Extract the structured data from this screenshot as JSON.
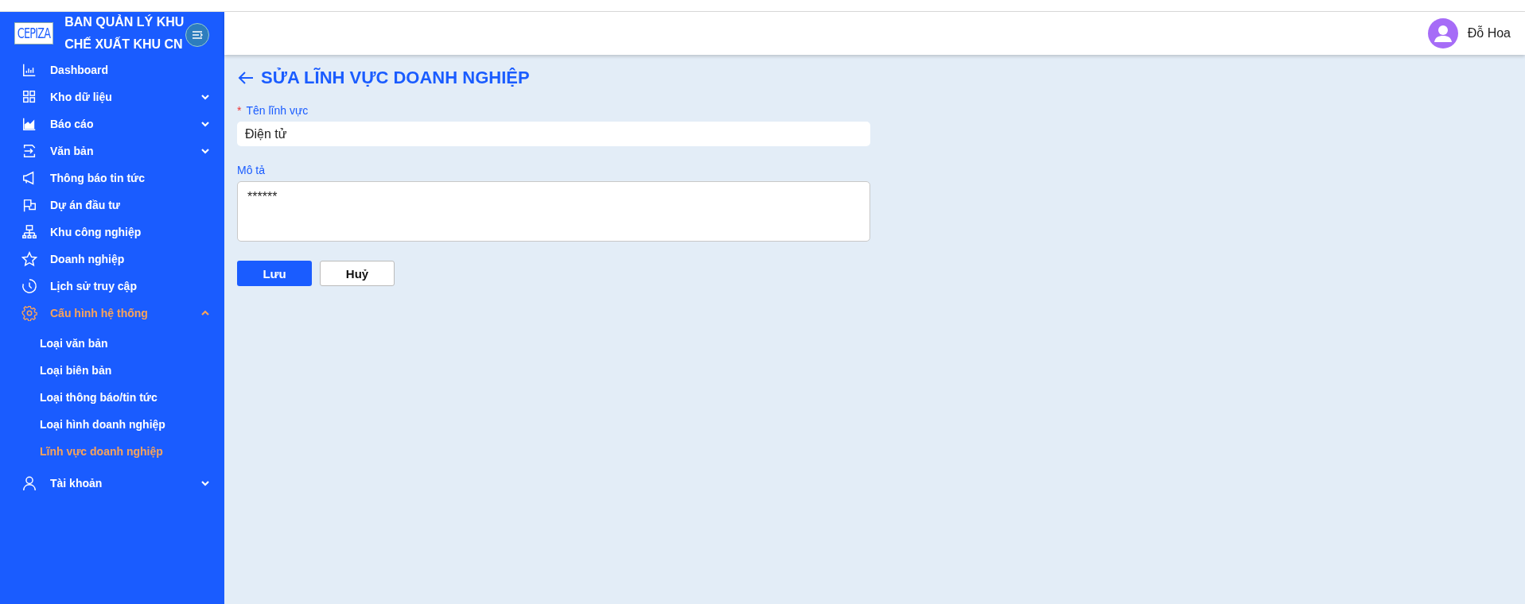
{
  "sidebar": {
    "logo": "CEPIZA",
    "title_lines": [
      "BAN QUẢN LÝ KHU",
      "CHẾ XUẤT KHU CN"
    ],
    "items": [
      {
        "label": "Dashboard",
        "selected": false
      },
      {
        "label": "Kho dữ liệu",
        "selected": false,
        "expanded": false
      },
      {
        "label": "Báo cáo",
        "selected": false,
        "expanded": false
      },
      {
        "label": "Văn bản",
        "selected": false,
        "expanded": false
      },
      {
        "label": "Thông báo tin tức",
        "selected": false
      },
      {
        "label": "Dự án đầu tư",
        "selected": false
      },
      {
        "label": "Khu công nghiệp",
        "selected": false
      },
      {
        "label": "Doanh nghiệp",
        "selected": false
      },
      {
        "label": "Lịch sử truy cập",
        "selected": false
      },
      {
        "label": "Cấu hình hệ thống",
        "selected": true,
        "expanded": true,
        "children": [
          {
            "label": "Loại văn bản",
            "selected": false
          },
          {
            "label": "Loại biên bản",
            "selected": false
          },
          {
            "label": "Loại thông báo/tin tức",
            "selected": false
          },
          {
            "label": "Loại hình doanh nghiệp",
            "selected": false
          },
          {
            "label": "Lĩnh vực doanh nghiệp",
            "selected": true
          }
        ]
      },
      {
        "label": "Tài khoản",
        "selected": false,
        "expanded": false
      }
    ]
  },
  "header": {
    "user_name": "Đỗ Hoa"
  },
  "form": {
    "title": "SỬA LĨNH VỰC DOANH NGHIỆP",
    "fields": [
      {
        "label": "Tên lĩnh vực",
        "required_mark": "*",
        "kind": "input",
        "value": "Điện tử"
      },
      {
        "label": "Mô tả",
        "kind": "textarea",
        "value": "******"
      }
    ],
    "buttons": [
      {
        "label": "Lưu",
        "kind": "primary"
      },
      {
        "label": "Huỷ",
        "kind": "secondary"
      }
    ]
  }
}
